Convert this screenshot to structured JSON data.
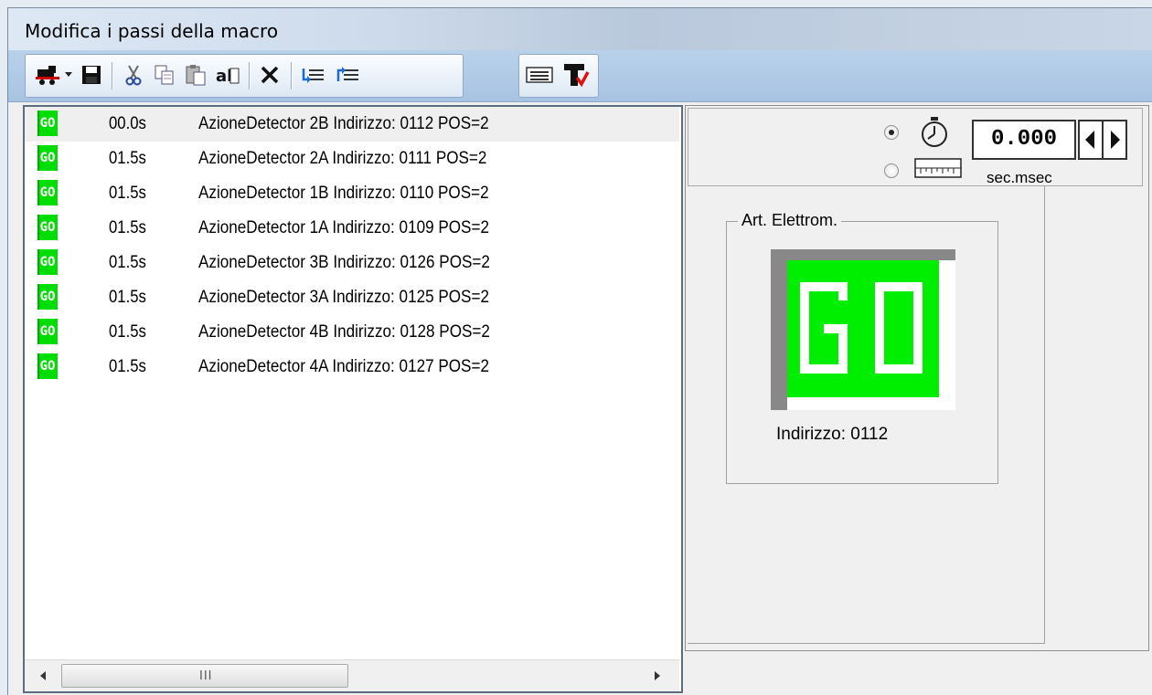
{
  "window": {
    "title": "Modifica i passi della macro"
  },
  "toolbar": {
    "icons": [
      "locomotive-icon",
      "dropdown-arrow-icon",
      "save-icon",
      "cut-icon",
      "copy-icon",
      "paste-icon",
      "paste-special-icon",
      "delete-icon",
      "move-down-icon",
      "move-up-icon",
      "keyboard-icon",
      "text-edit-icon"
    ]
  },
  "steps": [
    {
      "badge": "GO",
      "time": "00.0s",
      "desc": "AzioneDetector 2B Indirizzo: 0112 POS=2",
      "selected": true
    },
    {
      "badge": "GO",
      "time": "01.5s",
      "desc": "AzioneDetector 2A Indirizzo: 0111 POS=2"
    },
    {
      "badge": "GO",
      "time": "01.5s",
      "desc": "AzioneDetector 1B Indirizzo: 0110 POS=2"
    },
    {
      "badge": "GO",
      "time": "01.5s",
      "desc": "AzioneDetector 1A Indirizzo: 0109 POS=2"
    },
    {
      "badge": "GO",
      "time": "01.5s",
      "desc": "AzioneDetector 3B Indirizzo: 0126 POS=2"
    },
    {
      "badge": "GO",
      "time": "01.5s",
      "desc": "AzioneDetector 3A Indirizzo: 0125 POS=2"
    },
    {
      "badge": "GO",
      "time": "01.5s",
      "desc": "AzioneDetector 4B Indirizzo: 0128 POS=2"
    },
    {
      "badge": "GO",
      "time": "01.5s",
      "desc": "AzioneDetector 4A Indirizzo: 0127 POS=2"
    }
  ],
  "timing": {
    "value": "0.000",
    "units": "sec.msec",
    "mode_options": [
      "stopwatch-icon",
      "ruler-icon"
    ],
    "selected_mode": "stopwatch-icon"
  },
  "detail": {
    "group_label": "Art. Elettrom.",
    "preview_text": "GO",
    "address": "Indirizzo: 0112"
  },
  "colors": {
    "go_green": "#00ee00",
    "toolbar_blue": "#b9d1ea"
  }
}
